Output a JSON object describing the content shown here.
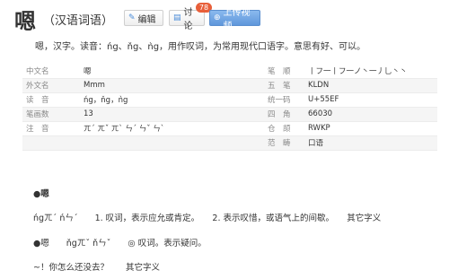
{
  "header": {
    "title": "嗯",
    "subtitle": "（汉语词语）",
    "edit_label": "编辑",
    "discuss_label": "讨论",
    "discuss_count": "78",
    "upload_label": "上传视频"
  },
  "summary": "嗯，汉字。读音：ńg、ňg、ǹg，用作叹词，为常用现代口语字。意思有好、可以。",
  "info_rows": [
    {
      "l1": "中文名",
      "v1": "嗯",
      "l2": "笔　顺",
      "v2": "丨フ一丨フ一ノ丶一丿乚丶丶"
    },
    {
      "l1": "外文名",
      "v1": "Mmm",
      "l2": "五　笔",
      "v2": "KLDN"
    },
    {
      "l1": "读　音",
      "v1": "ńg，ňg，ǹg",
      "l2": "统一码",
      "v2": "U+55EF"
    },
    {
      "l1": "笔画数",
      "v1": "13",
      "l2": "四　角",
      "v2": "66030"
    },
    {
      "l1": "注　音",
      "v1": "ㄫˊ ㄫˇ ㄫˋ ㄣˊ ㄣˇ ㄣˋ",
      "l2": "仓　颉",
      "v2": "RWKP"
    },
    {
      "l1": "",
      "v1": "",
      "l2": "范　畴",
      "v2": "口语"
    }
  ],
  "sections": {
    "s1_head": "●嗯",
    "s1_line": "ńgㄫˊ ńㄣˊ　　1. 叹词，表示应允或肯定。　　2. 表示叹惜，或语气上的间歇。　　其它字义",
    "s2_line": "●嗯　　ňgㄫˇ ňㄣˇ　　◎ 叹词。表示疑问。",
    "s3_line": "~！你怎么还没去？　　其它字义"
  }
}
